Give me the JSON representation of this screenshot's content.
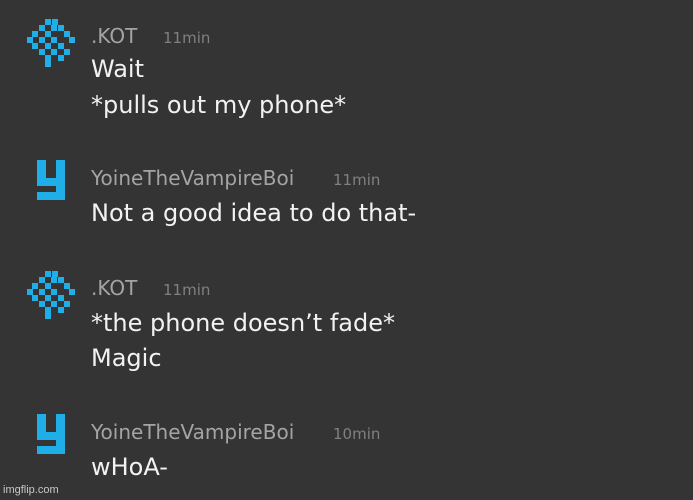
{
  "colors": {
    "background": "#343434",
    "username": "#a4a4a4",
    "timestamp": "#808080",
    "message_text": "#f2f2f2",
    "avatar_accent": "#1faee8"
  },
  "messages": [
    {
      "username": ".KOT",
      "time": "11min",
      "avatar_icon": "pixel-diamond-avatar-icon",
      "lines": [
        "Wait",
        "*pulls out my phone*"
      ]
    },
    {
      "username": "YoineTheVampireBoi",
      "time": "11min",
      "avatar_icon": "pixel-y-avatar-icon",
      "lines": [
        "Not a good idea to do that-"
      ]
    },
    {
      "username": ".KOT",
      "time": "11min",
      "avatar_icon": "pixel-diamond-avatar-icon",
      "lines": [
        "*the phone doesn’t fade*",
        "Magic"
      ]
    },
    {
      "username": "YoineTheVampireBoi",
      "time": "10min",
      "avatar_icon": "pixel-y-avatar-icon",
      "lines": [
        "wHoA-"
      ]
    }
  ],
  "watermark": "imgflip.com"
}
